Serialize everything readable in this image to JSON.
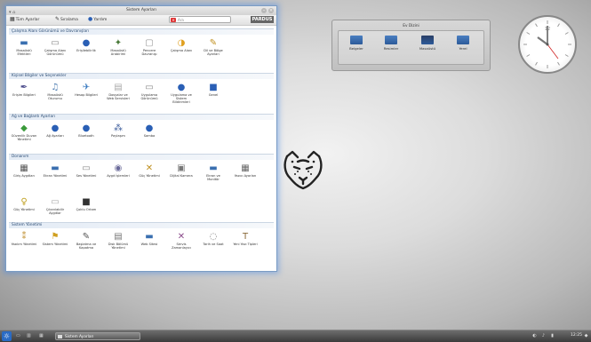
{
  "window": {
    "title": "Sistem Ayarları",
    "toolbar": {
      "overview_label": "Tüm Ayarlar",
      "sort_label": "Sıralama",
      "help_label": "Yardım",
      "search_placeholder": "Ara",
      "logo_text": "PARDUS"
    },
    "sections": [
      {
        "title": "Çalışma Alanı Görünümü ve Davranışları",
        "items": [
          {
            "label": "Masaüstü Efektleri",
            "icon": "monitor-icon",
            "glyph": "▬",
            "color": "#3a6fb0"
          },
          {
            "label": "Çalışma Alanı Görünümü",
            "icon": "window-icon",
            "glyph": "▭",
            "color": "#888888"
          },
          {
            "label": "Erişilebilirlik",
            "icon": "accessibility-icon",
            "glyph": "●",
            "color": "#2a5fb5"
          },
          {
            "label": "Masaüstü Arabirimi",
            "icon": "desktop-tools-icon",
            "glyph": "✦",
            "color": "#4a7a3a"
          },
          {
            "label": "Pencere Davranışı",
            "icon": "window-behavior-icon",
            "glyph": "▢",
            "color": "#999999"
          },
          {
            "label": "Çalışma Alanı",
            "icon": "workspace-icon",
            "glyph": "◑",
            "color": "#e0a020"
          },
          {
            "label": "Dil ve Bölge Ayarları",
            "icon": "locale-icon",
            "glyph": "✎",
            "color": "#c09020"
          }
        ]
      },
      {
        "title": "Kişisel Bilgiler ve Seçenekler",
        "items": [
          {
            "label": "Erişim Bilgileri",
            "icon": "key-icon",
            "glyph": "✒",
            "color": "#4a4a8a"
          },
          {
            "label": "Masaüstü Oturumu",
            "icon": "session-icon",
            "glyph": "♫",
            "color": "#4a7ab0"
          },
          {
            "label": "Hesap Bilgileri",
            "icon": "account-icon",
            "glyph": "✈",
            "color": "#3a7ac0"
          },
          {
            "label": "Dosyalar ve Web Servisleri",
            "icon": "files-icon",
            "glyph": "▤",
            "color": "#aaaaaa"
          },
          {
            "label": "Uygulama Görünümü",
            "icon": "app-appearance-icon",
            "glyph": "▭",
            "color": "#888888"
          },
          {
            "label": "Uygulama ve Sistem Bildirimleri",
            "icon": "notifications-icon",
            "glyph": "●",
            "color": "#2a5fb5"
          },
          {
            "label": "Genel",
            "icon": "general-icon",
            "glyph": "■",
            "color": "#2a5fb5"
          }
        ]
      },
      {
        "title": "Ağ ve Bağlantı Ayarları",
        "items": [
          {
            "label": "Güvenlik Duvarı Yönetimi",
            "icon": "firewall-icon",
            "glyph": "◆",
            "color": "#3a9a3a"
          },
          {
            "label": "Ağ Ayarları",
            "icon": "network-icon",
            "glyph": "●",
            "color": "#2a5fb5"
          },
          {
            "label": "Bluetooth",
            "icon": "bluetooth-icon",
            "glyph": "●",
            "color": "#2a5fb5"
          },
          {
            "label": "Paylaşım",
            "icon": "sharing-icon",
            "glyph": "⁂",
            "color": "#3a5a9a"
          },
          {
            "label": "Samba",
            "icon": "samba-icon",
            "glyph": "●",
            "color": "#2a5fb5"
          }
        ]
      },
      {
        "title": "Donanım",
        "items": [
          {
            "label": "Giriş Aygıtları",
            "icon": "input-devices-icon",
            "glyph": "▦",
            "color": "#555555"
          },
          {
            "label": "Ekran Yönetimi",
            "icon": "display-icon",
            "glyph": "▬",
            "color": "#3a6fb0"
          },
          {
            "label": "Ses Yönetimi",
            "icon": "audio-icon",
            "glyph": "▭",
            "color": "#888888"
          },
          {
            "label": "Aygıt İşlemleri",
            "icon": "device-actions-icon",
            "glyph": "◉",
            "color": "#6a6a9a"
          },
          {
            "label": "Güç Yönetimi",
            "icon": "power-icon",
            "glyph": "✕",
            "color": "#c09020"
          },
          {
            "label": "Dijital Kamera",
            "icon": "camera-icon",
            "glyph": "▣",
            "color": "#777777"
          },
          {
            "label": "Ekran ve Monitör",
            "icon": "monitor-settings-icon",
            "glyph": "▬",
            "color": "#3a6fb0"
          },
          {
            "label": "Yazıcı Ayarları",
            "icon": "printer-icon",
            "glyph": "▦",
            "color": "#666666"
          },
          {
            "label": "Güç Yönetimi",
            "icon": "power-management-icon",
            "glyph": "♀",
            "color": "#c0a020"
          },
          {
            "label": "Çıkarılabilir Aygıtlar",
            "icon": "removable-icon",
            "glyph": "▭",
            "color": "#aaaaaa"
          },
          {
            "label": "Çoklu Ortam",
            "icon": "multimedia-icon",
            "glyph": "■",
            "color": "#333333"
          }
        ]
      },
      {
        "title": "Sistem Yönetimi",
        "items": [
          {
            "label": "Yazılım Yönetimi",
            "icon": "software-icon",
            "glyph": "⁑",
            "color": "#c09030"
          },
          {
            "label": "Sistem Yönetimi",
            "icon": "flag-icon",
            "glyph": "⚑",
            "color": "#d0a020"
          },
          {
            "label": "Başlatma ve Kapatma",
            "icon": "startup-icon",
            "glyph": "✎",
            "color": "#555555"
          },
          {
            "label": "Disk Bölümü Yönetimi",
            "icon": "disk-icon",
            "glyph": "▤",
            "color": "#777777"
          },
          {
            "label": "Web Sitesi",
            "icon": "web-icon",
            "glyph": "▬",
            "color": "#3a6fb0"
          },
          {
            "label": "Servis Zamanlayıcı",
            "icon": "scheduler-icon",
            "glyph": "✕",
            "color": "#8a4a8a"
          },
          {
            "label": "Tarih ve Saat",
            "icon": "date-time-icon",
            "glyph": "◌",
            "color": "#777777"
          },
          {
            "label": "Yeni Yazı Tipleri",
            "icon": "fonts-icon",
            "glyph": "T",
            "color": "#8a6a3a"
          }
        ]
      }
    ]
  },
  "folderview": {
    "title": "Ev Dizini",
    "items": [
      {
        "label": "Belgeler",
        "color": "#4a7fc1"
      },
      {
        "label": "Resimler",
        "color": "#4a7fc1"
      },
      {
        "label": "Masaüstü",
        "color": "#2a3f66"
      },
      {
        "label": "Yerel",
        "color": "#4a7fc1"
      }
    ]
  },
  "clock": {
    "label": "12"
  },
  "panel": {
    "task_label": "Sistem Ayarları",
    "time_text": "12:25"
  }
}
